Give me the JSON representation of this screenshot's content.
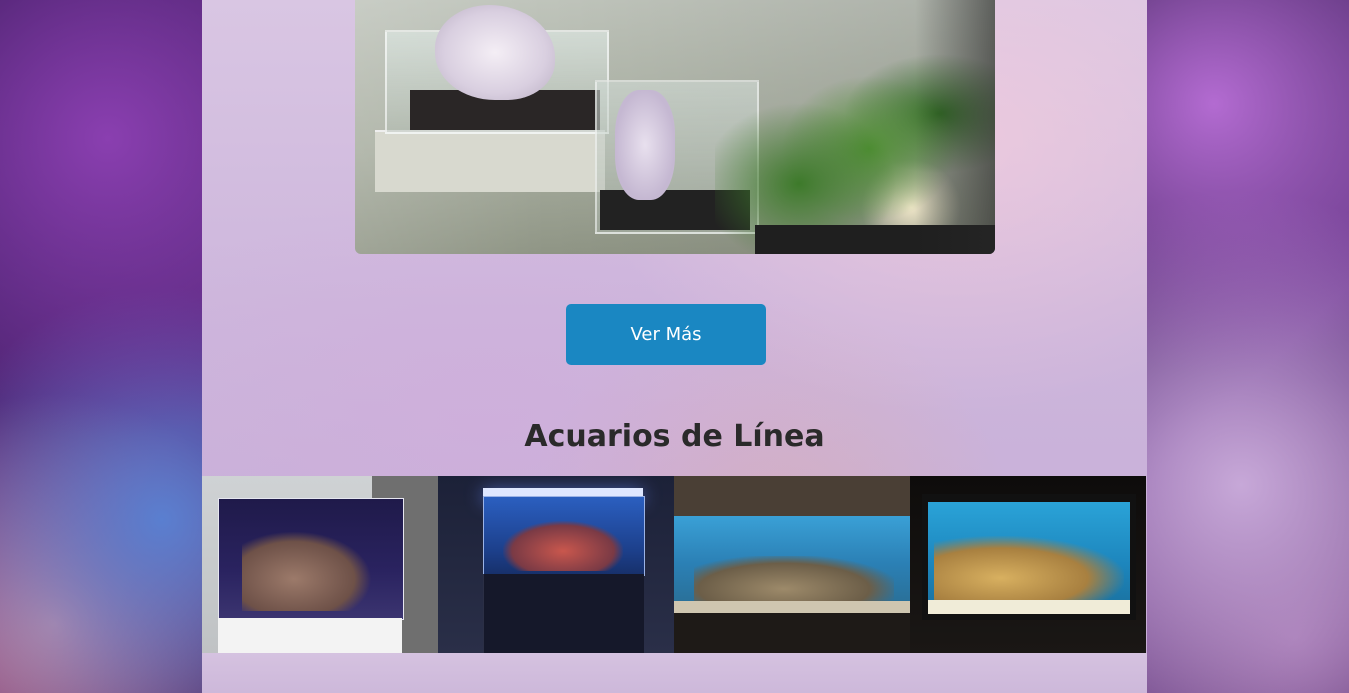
{
  "actions": {
    "more_label": "Ver Más"
  },
  "section": {
    "title": "Acuarios de Línea"
  },
  "gallery": {
    "items": [
      {
        "icon": "aquarium-image"
      },
      {
        "icon": "aquarium-image"
      },
      {
        "icon": "aquarium-image"
      },
      {
        "icon": "aquarium-image"
      }
    ]
  },
  "colors": {
    "button": "#1a87c2",
    "button_text": "#ffffff",
    "title_text": "#2a2a2a"
  }
}
